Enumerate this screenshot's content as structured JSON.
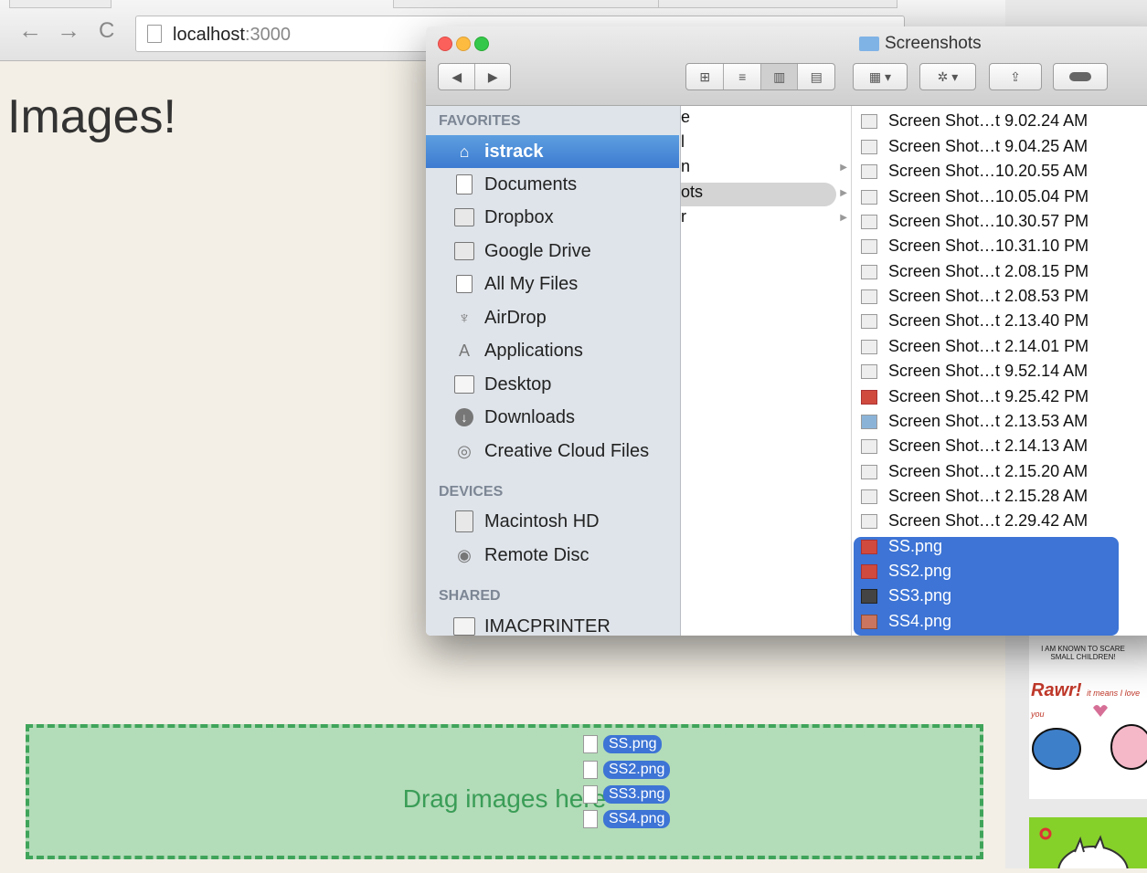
{
  "browser": {
    "back_icon": "←",
    "forward_icon": "→",
    "reload_icon": "C",
    "url_host": "localhost",
    "url_port": ":3000"
  },
  "page": {
    "title": "Images!",
    "dropzone_label": "Drag images here",
    "dragged_files": [
      "SS.png",
      "SS2.png",
      "SS3.png",
      "SS4.png"
    ],
    "side_caption": "I AM KNOWN TO SCARE SMALL CHILDREN!",
    "rawr_title": "Rawr!",
    "rawr_sub": "it means I love you"
  },
  "finder": {
    "title": "Screenshots",
    "sidebar": {
      "favorites_header": "FAVORITES",
      "favorites": [
        {
          "label": "istrack",
          "icon": "home-icon",
          "selected": true
        },
        {
          "label": "Documents",
          "icon": "documents-icon"
        },
        {
          "label": "Dropbox",
          "icon": "folder-icon"
        },
        {
          "label": "Google Drive",
          "icon": "folder-icon"
        },
        {
          "label": "All My Files",
          "icon": "all-files-icon"
        },
        {
          "label": "AirDrop",
          "icon": "airdrop-icon"
        },
        {
          "label": "Applications",
          "icon": "applications-icon"
        },
        {
          "label": "Desktop",
          "icon": "desktop-icon"
        },
        {
          "label": "Downloads",
          "icon": "downloads-icon"
        },
        {
          "label": "Creative Cloud Files",
          "icon": "creative-cloud-icon"
        }
      ],
      "devices_header": "DEVICES",
      "devices": [
        {
          "label": "Macintosh HD",
          "icon": "harddisk-icon"
        },
        {
          "label": "Remote Disc",
          "icon": "disc-icon"
        }
      ],
      "shared_header": "SHARED",
      "shared": [
        {
          "label": "IMACPRINTER",
          "icon": "monitor-icon"
        }
      ]
    },
    "column2": [
      "e",
      "l",
      "n",
      "ots",
      "r"
    ],
    "files": [
      "Screen Shot…t 9.02.24 AM",
      "Screen Shot…t 9.04.25 AM",
      "Screen Shot…10.20.55 AM",
      "Screen Shot…10.05.04 PM",
      "Screen Shot…10.30.57 PM",
      "Screen Shot…10.31.10 PM",
      "Screen Shot…t 2.08.15 PM",
      "Screen Shot…t 2.08.53 PM",
      "Screen Shot…t 2.13.40 PM",
      "Screen Shot…t 2.14.01 PM",
      "Screen Shot…t 9.52.14 AM",
      "Screen Shot…t 9.25.42 PM",
      "Screen Shot…t 2.13.53 AM",
      "Screen Shot…t 2.14.13 AM",
      "Screen Shot…t 2.15.20 AM",
      "Screen Shot…t 2.15.28 AM",
      "Screen Shot…t 2.29.42 AM"
    ],
    "selected_files": [
      "SS.png",
      "SS2.png",
      "SS3.png",
      "SS4.png"
    ]
  }
}
